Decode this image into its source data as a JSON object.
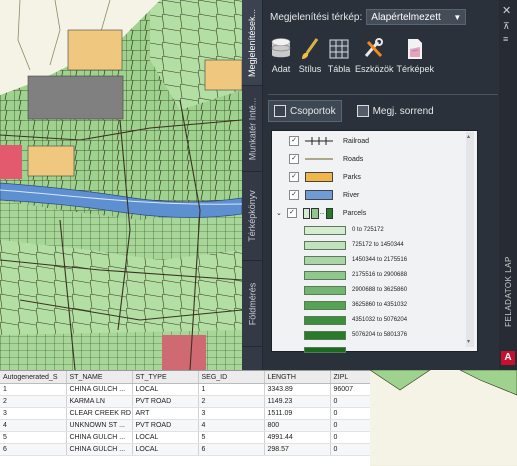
{
  "palette": {
    "vertical_tabs": [
      "Megjelenítések...",
      "Munkatér Inté...",
      "Térképkönyv",
      "Földmérés"
    ],
    "display_map_label": "Megjelenítési térkép:",
    "display_map_value": "Alapértelmezett",
    "tools": [
      {
        "label": "Adat",
        "icon": "database-icon"
      },
      {
        "label": "Stílus",
        "icon": "brush-icon"
      },
      {
        "label": "Tábla",
        "icon": "table-icon"
      },
      {
        "label": "Eszközök",
        "icon": "tools-icon"
      },
      {
        "label": "Térképek",
        "icon": "maps-icon"
      }
    ],
    "view_tabs": {
      "groups": "Csoportok",
      "draw_order": "Megj. sorrend"
    },
    "layers": [
      {
        "name": "Railroad",
        "checked": true,
        "symbol": "railroad-line"
      },
      {
        "name": "Roads",
        "checked": true,
        "symbol": "road-line"
      },
      {
        "name": "Parks",
        "checked": true,
        "symbol": "fill",
        "color": "#f0b64a"
      },
      {
        "name": "River",
        "checked": true,
        "symbol": "fill",
        "color": "#6f9bd6"
      },
      {
        "name": "Parcels",
        "checked": true,
        "symbol": "theme",
        "expanded": true
      }
    ],
    "parcel_ranges": [
      {
        "label": "0 to 725172",
        "color": "#d5ecd2"
      },
      {
        "label": "725172 to 1450344",
        "color": "#c2e2bf"
      },
      {
        "label": "1450344 to 2175516",
        "color": "#aad6a7"
      },
      {
        "label": "2175516 to 2900688",
        "color": "#8fc78d"
      },
      {
        "label": "2900688 to 3625860",
        "color": "#73b672"
      },
      {
        "label": "3625860 to 4351032",
        "color": "#57a356"
      },
      {
        "label": "4351032 to 5076204",
        "color": "#3d8f3e"
      },
      {
        "label": "5076204 to 5801376",
        "color": "#2a7a2c"
      },
      {
        "label": "",
        "color": "#1a6a1d"
      }
    ],
    "side_title": "FELADATOK LAP"
  },
  "table": {
    "columns": [
      "Autogenerated_S",
      "ST_NAME",
      "ST_TYPE",
      "SEG_ID",
      "LENGTH",
      "ZIPL"
    ],
    "rows": [
      [
        "1",
        "CHINA GULCH ...",
        "LOCAL",
        "1",
        "3343.89",
        "96007"
      ],
      [
        "2",
        "KARMA LN",
        "PVT ROAD",
        "2",
        "1149.23",
        "0"
      ],
      [
        "3",
        "CLEAR CREEK RD",
        "ART",
        "3",
        "1511.09",
        "0"
      ],
      [
        "4",
        "UNKNOWN ST ...",
        "PVT ROAD",
        "4",
        "800",
        "0"
      ],
      [
        "5",
        "CHINA GULCH ...",
        "LOCAL",
        "5",
        "4991.44",
        "0"
      ],
      [
        "6",
        "CHINA GULCH ...",
        "LOCAL",
        "6",
        "298.57",
        "0"
      ]
    ]
  },
  "colors": {
    "parcel_fill": "#9fd18f",
    "park": "#f0c77e",
    "river": "#5e8fd0",
    "block_gray": "#808080",
    "block_red": "#e35a6f"
  }
}
